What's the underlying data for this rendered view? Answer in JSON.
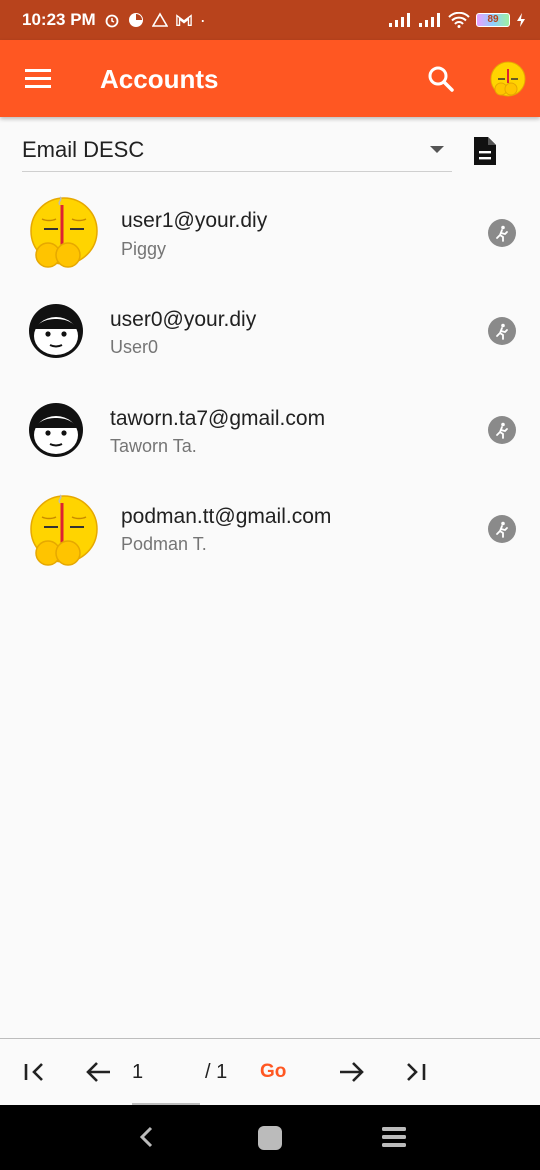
{
  "status_bar": {
    "time": "10:23 PM",
    "battery": "89"
  },
  "app_bar": {
    "title": "Accounts",
    "menu_icon": "hamburger-menu-icon",
    "search_icon": "search-icon"
  },
  "sort": {
    "selected": "Email DESC"
  },
  "accounts": [
    {
      "email": "user1@your.diy",
      "name": "Piggy",
      "avatar": "emoji-face-avatar"
    },
    {
      "email": "user0@your.diy",
      "name": "User0",
      "avatar": "cartoon-face-avatar"
    },
    {
      "email": "taworn.ta7@gmail.com",
      "name": "Taworn Ta.",
      "avatar": "cartoon-face-avatar"
    },
    {
      "email": "podman.tt@gmail.com",
      "name": "Podman T.",
      "avatar": "emoji-face-avatar"
    }
  ],
  "pager": {
    "page": "1",
    "total": "/ 1",
    "go_label": "Go"
  },
  "colors": {
    "primary": "#ff5722",
    "status_bar": "#b8431c"
  }
}
